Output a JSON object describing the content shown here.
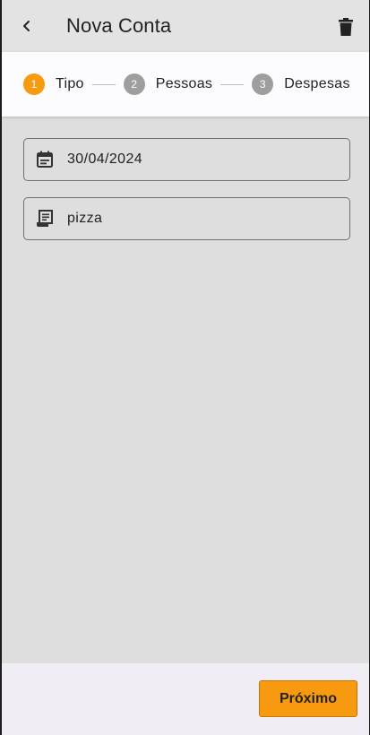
{
  "appbar": {
    "title": "Nova Conta",
    "back_icon": "chevron-left-icon",
    "delete_icon": "trash-icon"
  },
  "stepper": {
    "steps": [
      {
        "number": "1",
        "label": "Tipo",
        "active": true
      },
      {
        "number": "2",
        "label": "Pessoas",
        "active": false
      },
      {
        "number": "3",
        "label": "Despesas",
        "active": false
      }
    ]
  },
  "form": {
    "date": {
      "icon": "calendar-icon",
      "value": "30/04/2024"
    },
    "description": {
      "icon": "receipt-icon",
      "value": "pizza"
    }
  },
  "footer": {
    "next_label": "Próximo"
  },
  "colors": {
    "accent": "#f79a10",
    "inactive_step": "#9e9e9e",
    "background": "#dedede"
  }
}
